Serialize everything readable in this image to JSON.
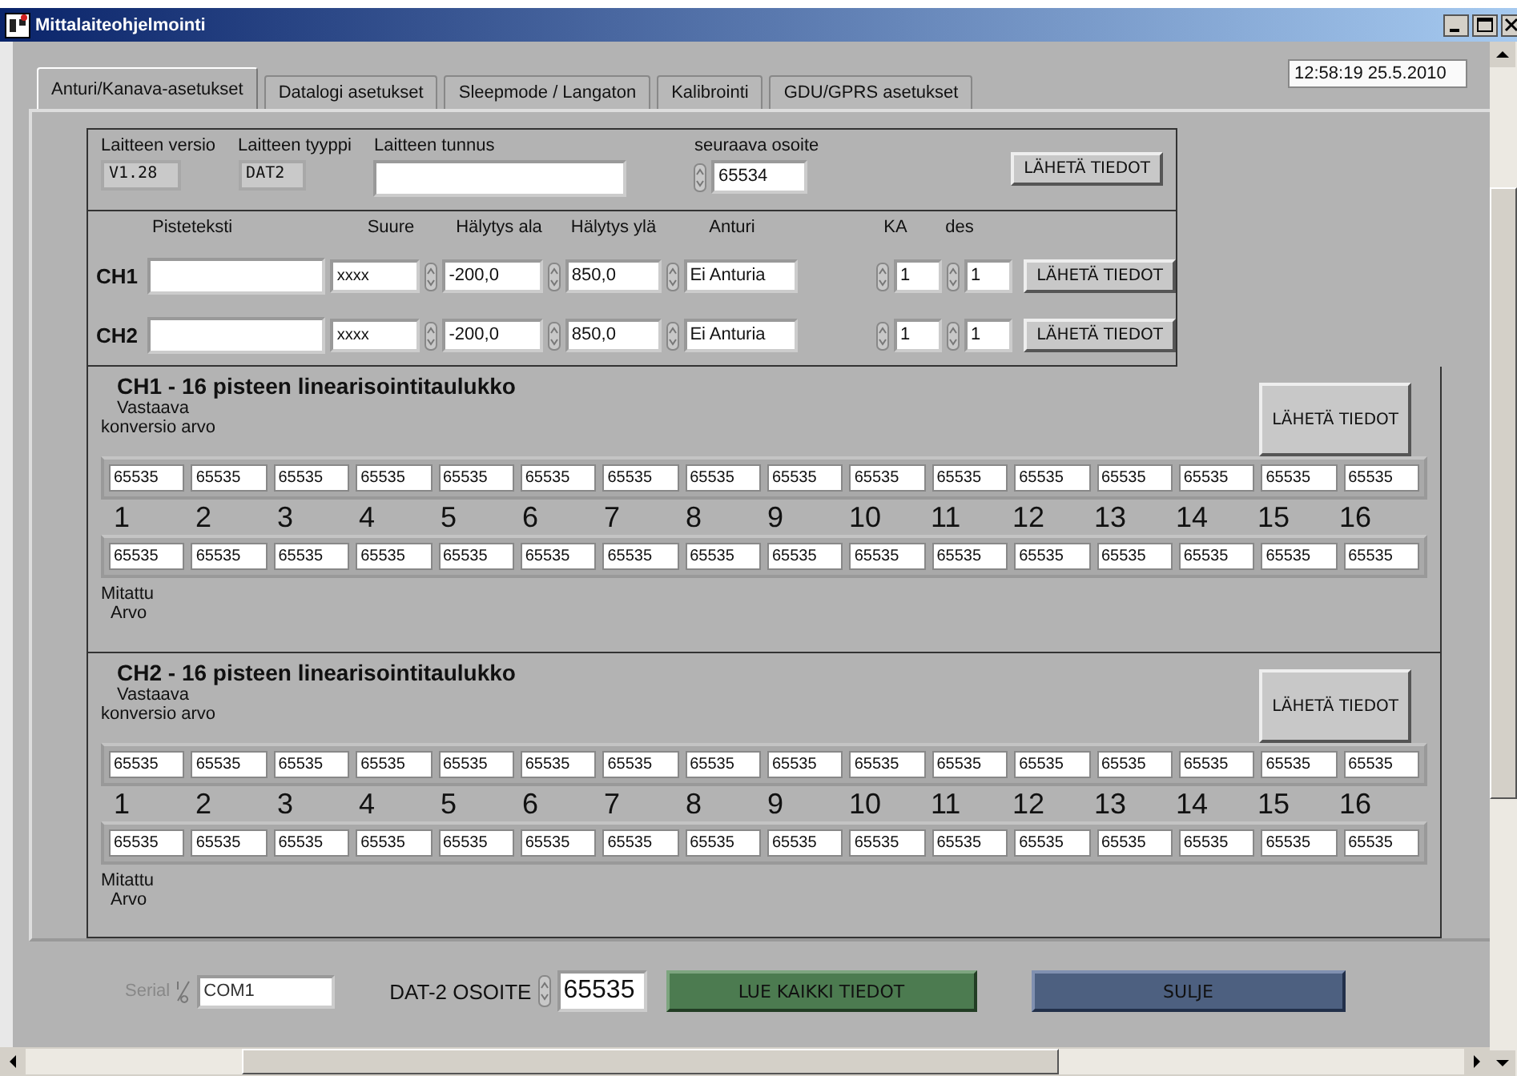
{
  "window": {
    "title": "Mittalaiteohjelmointi"
  },
  "tabs": [
    {
      "label": "Anturi/Kanava-asetukset",
      "selected": true
    },
    {
      "label": "Datalogi asetukset",
      "selected": false
    },
    {
      "label": "Sleepmode / Langaton",
      "selected": false
    },
    {
      "label": "Kalibrointi",
      "selected": false
    },
    {
      "label": "GDU/GPRS asetukset",
      "selected": false
    }
  ],
  "datetime": "12:58:19  25.5.2010",
  "device": {
    "version": {
      "label": "Laitteen versio",
      "value": "V1.28"
    },
    "type": {
      "label": "Laitteen tyyppi",
      "value": "DAT2"
    },
    "id": {
      "label": "Laitteen tunnus"
    },
    "next_address": {
      "label": "seuraava osoite",
      "value": "65534"
    },
    "send_button": "LÄHETÄ TIEDOT"
  },
  "channel_columns": {
    "point_text": "Pisteteksti",
    "quantity": "Suure",
    "alarm_low": "Hälytys ala",
    "alarm_high": "Hälytys ylä",
    "sensor": "Anturi",
    "ka": "KA",
    "des": "des"
  },
  "channels": [
    {
      "name": "CH1",
      "quantity": "xxxx",
      "alarm_low": "-200,0",
      "alarm_high": "850,0",
      "sensor": "Ei Anturia",
      "ka": "1",
      "des": "1",
      "button": "LÄHETÄ TIEDOT"
    },
    {
      "name": "CH2",
      "quantity": "xxxx",
      "alarm_low": "-200,0",
      "alarm_high": "850,0",
      "sensor": "Ei Anturia",
      "ka": "1",
      "des": "1",
      "button": "LÄHETÄ TIEDOT"
    }
  ],
  "tables": [
    {
      "title": "CH1 - 16 pisteen linearisointitaulukko",
      "button": "LÄHETÄ TIEDOT",
      "top_label": [
        "Vastaava",
        "konversio arvo"
      ],
      "converted": [
        "65535",
        "65535",
        "65535",
        "65535",
        "65535",
        "65535",
        "65535",
        "65535",
        "65535",
        "65535",
        "65535",
        "65535",
        "65535",
        "65535",
        "65535",
        "65535"
      ],
      "indices": [
        "1",
        "2",
        "3",
        "4",
        "5",
        "6",
        "7",
        "8",
        "9",
        "10",
        "11",
        "12",
        "13",
        "14",
        "15",
        "16"
      ],
      "measured": [
        "65535",
        "65535",
        "65535",
        "65535",
        "65535",
        "65535",
        "65535",
        "65535",
        "65535",
        "65535",
        "65535",
        "65535",
        "65535",
        "65535",
        "65535",
        "65535"
      ],
      "bottom_label": [
        "Mitattu",
        "Arvo"
      ]
    },
    {
      "title": "CH2 - 16 pisteen linearisointitaulukko",
      "button": "LÄHETÄ TIEDOT",
      "top_label": [
        "Vastaava",
        "konversio arvo"
      ],
      "converted": [
        "65535",
        "65535",
        "65535",
        "65535",
        "65535",
        "65535",
        "65535",
        "65535",
        "65535",
        "65535",
        "65535",
        "65535",
        "65535",
        "65535",
        "65535",
        "65535"
      ],
      "indices": [
        "1",
        "2",
        "3",
        "4",
        "5",
        "6",
        "7",
        "8",
        "9",
        "10",
        "11",
        "12",
        "13",
        "14",
        "15",
        "16"
      ],
      "measured": [
        "65535",
        "65535",
        "65535",
        "65535",
        "65535",
        "65535",
        "65535",
        "65535",
        "65535",
        "65535",
        "65535",
        "65535",
        "65535",
        "65535",
        "65535",
        "65535"
      ],
      "bottom_label": [
        "Mitattu",
        "Arvo"
      ]
    }
  ],
  "footer": {
    "serial": {
      "label": "Serial",
      "value": "COM1",
      "disabled": true
    },
    "address": {
      "label": "DAT-2 OSOITE",
      "value": "65535"
    },
    "buttons": [
      {
        "label": "LUE KAIKKI TIEDOT",
        "kind": "read"
      },
      {
        "label": "SULJE",
        "kind": "close"
      }
    ]
  }
}
